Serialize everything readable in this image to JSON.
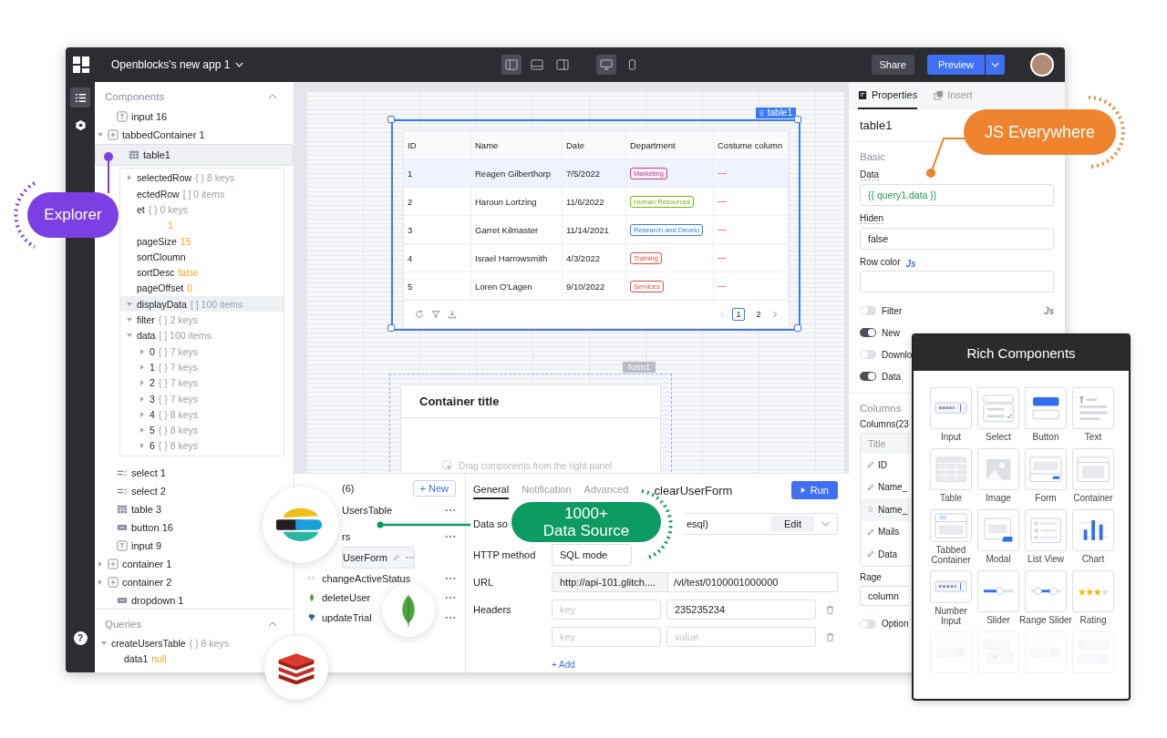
{
  "topbar": {
    "app_title": "Openblocks's new app 1",
    "layout_modes": [
      {
        "selected": true
      },
      {
        "selected": false
      },
      {
        "selected": false
      }
    ],
    "devices": [
      {
        "kind": "desktop",
        "selected": true
      },
      {
        "kind": "mobile",
        "selected": false
      }
    ],
    "share": "Share",
    "preview": "Preview"
  },
  "rail": {
    "items": [
      {
        "kind": "tree",
        "selected": true
      },
      {
        "kind": "hexagon",
        "selected": false
      }
    ],
    "help": "?"
  },
  "components": {
    "title": "Components",
    "items": [
      {
        "label": "input 16",
        "kind": "input"
      },
      {
        "label": "tabbedContainer 1",
        "kind": "container",
        "expanded": true
      },
      {
        "label": "table1",
        "kind": "table",
        "selected": true
      }
    ]
  },
  "explorer": {
    "rows": [
      {
        "name": "selectedRow",
        "meta": "{ } 8 keys",
        "expanded": false,
        "selected": false
      },
      {
        "name": "ectedRow",
        "meta": "[ ] 0 items",
        "selected": false
      },
      {
        "name": "et",
        "meta": "{ } 0 keys",
        "selected": false
      },
      {
        "value": "1",
        "selected": false
      },
      {
        "name": "pageSize",
        "value": "15",
        "selected": false
      },
      {
        "name": "sortCloumn",
        "selected": false
      },
      {
        "name": "sortDesc",
        "value": "false",
        "selected": false
      },
      {
        "name": "pageOffset",
        "value": "0",
        "selected": false
      },
      {
        "name": "displayData",
        "meta": "[ ] 100 items",
        "expanded": true,
        "selected": true
      },
      {
        "name": "filter",
        "meta": "{ } 2 keys",
        "expanded": true,
        "selected": false
      },
      {
        "name": "data",
        "meta": "[ ] 100 items",
        "expanded": true,
        "selected": false,
        "children": [
          {
            "name": "0",
            "meta": "{ } 7 keys",
            "expanded": false
          },
          {
            "name": "1",
            "meta": "{ } 7 keys",
            "expanded": false
          },
          {
            "name": "2",
            "meta": "{ } 7 keys",
            "expanded": false
          },
          {
            "name": "3",
            "meta": "{ } 7 keys",
            "expanded": false
          },
          {
            "name": "4",
            "meta": "{ } 8 keys",
            "expanded": false
          },
          {
            "name": "5",
            "meta": "{ } 8 keys",
            "expanded": false
          },
          {
            "name": "6",
            "meta": "{ } 8 keys",
            "expanded": false
          }
        ]
      }
    ]
  },
  "components_more": [
    {
      "label": "select 1",
      "kind": "select"
    },
    {
      "label": "select 2",
      "kind": "select"
    },
    {
      "label": "table 3",
      "kind": "table"
    },
    {
      "label": "button 16",
      "kind": "button"
    },
    {
      "label": "input 9",
      "kind": "input"
    },
    {
      "label": "container 1",
      "kind": "container",
      "expanded": false
    },
    {
      "label": "container 2",
      "kind": "container",
      "expanded": false
    },
    {
      "label": "dropdown 1",
      "kind": "button"
    }
  ],
  "queries": {
    "title": "Queries",
    "items": [
      {
        "name": "createUsersTable",
        "meta": "{ } 8 keys",
        "expanded": true,
        "children": [
          {
            "name": "data1",
            "value": "null"
          }
        ]
      }
    ]
  },
  "table1": {
    "badge": "table1",
    "columns": [
      "ID",
      "Name",
      "Date",
      "Department",
      "Costume column"
    ],
    "rows": [
      {
        "id": "1",
        "name": "Reagen Gilberthorp",
        "date": "7/5/2022",
        "department": "Marketing",
        "color": "#d63384",
        "selected": true
      },
      {
        "id": "2",
        "name": "Haroun Lortzing",
        "date": "11/6/2022",
        "department": "Human Resources",
        "color": "#7cb305",
        "selected": false
      },
      {
        "id": "3",
        "name": "Garret Kilmaster",
        "date": "11/14/2021",
        "department": "Research and Develo",
        "color": "#2f80ed",
        "selected": false
      },
      {
        "id": "4",
        "name": "Israel Harrowsmith",
        "date": "4/3/2022",
        "department": "Training",
        "color": "#e5484d",
        "selected": false
      },
      {
        "id": "5",
        "name": "Loren O'Lagen",
        "date": "9/10/2022",
        "department": "Services",
        "color": "#e5484d",
        "selected": false
      }
    ],
    "pages": [
      {
        "label": "1",
        "selected": true
      },
      {
        "label": "2",
        "selected": false
      }
    ]
  },
  "form1": {
    "badge": "form1",
    "title": "Container title",
    "hint": "Drag components from the right panel"
  },
  "query_panel": {
    "count": "(6)",
    "new_button": "+ New",
    "items": [
      {
        "label": "UsersTable",
        "kind": "sql",
        "selected": false
      },
      {
        "label": "rs",
        "kind": "sql",
        "selected": false
      },
      {
        "label": "UserForm",
        "kind": "sql",
        "selected": true
      },
      {
        "label": "changeActiveStatus",
        "kind": "js",
        "selected": false
      },
      {
        "label": "deleteUser",
        "kind": "mongo",
        "selected": false
      },
      {
        "label": "updateTrial",
        "kind": "pg",
        "selected": false
      }
    ],
    "tabs": [
      {
        "label": "General",
        "selected": true
      },
      {
        "label": "Notification",
        "selected": false
      },
      {
        "label": "Advanced",
        "selected": false
      }
    ],
    "title": "clearUserForm",
    "run": "Run",
    "data_source": {
      "label": "Data so",
      "value": "esql)",
      "edit": "Edit"
    },
    "http_method": {
      "label": "HTTP method",
      "value": "SQL mode"
    },
    "url": {
      "label": "URL",
      "prefix": "http://api-101.glitch....",
      "path": "/vl/test/0100001000000"
    },
    "headers": {
      "label": "Headers",
      "rows": [
        {
          "key_placeholder": "key",
          "value": "235235234"
        },
        {
          "key_placeholder": "key",
          "value_placeholder": "value"
        }
      ],
      "add": "+ Add"
    }
  },
  "properties": {
    "tabs": [
      {
        "label": "Properties",
        "selected": true
      },
      {
        "label": "Insert",
        "selected": false
      }
    ],
    "title": "table1",
    "section": "Basic",
    "data": {
      "label": "Data",
      "value": "{{ query1.data }}"
    },
    "hidden": {
      "label": "Hiden",
      "value": "false"
    },
    "row_color": {
      "label": "Row color",
      "js": "Js"
    },
    "toggles": [
      {
        "label": "Filter",
        "on": false,
        "js": "Js"
      },
      {
        "label": "New",
        "on": true
      },
      {
        "label": "Downlo",
        "on": false
      },
      {
        "label": "Data",
        "on": true
      }
    ],
    "columns_section": "Columns",
    "columns_label": "Columns(23",
    "columns_header": "Title",
    "columns": [
      {
        "label": "ID",
        "kind": "edit"
      },
      {
        "label": "Name_",
        "kind": "edit"
      },
      {
        "label": "Name_",
        "kind": "drag"
      },
      {
        "label": "Mails",
        "kind": "edit"
      },
      {
        "label": "Data",
        "kind": "edit"
      }
    ],
    "rage": {
      "label": "Rage",
      "value": "column"
    },
    "option": {
      "label": "Option",
      "on": false
    }
  },
  "rich_components": {
    "title": "Rich Components",
    "items": [
      {
        "label": "Input",
        "kind": "input"
      },
      {
        "label": "Select",
        "kind": "select"
      },
      {
        "label": "Button",
        "kind": "button"
      },
      {
        "label": "Text",
        "kind": "text"
      },
      {
        "label": "Table",
        "kind": "table"
      },
      {
        "label": "Image",
        "kind": "image"
      },
      {
        "label": "Form",
        "kind": "form"
      },
      {
        "label": "Container",
        "kind": "container"
      },
      {
        "label": "Tabbed Container",
        "kind": "tabbed"
      },
      {
        "label": "Modal",
        "kind": "modal"
      },
      {
        "label": "List View",
        "kind": "list"
      },
      {
        "label": "Chart",
        "kind": "chart"
      },
      {
        "label": "Number Input",
        "kind": "number"
      },
      {
        "label": "Slider",
        "kind": "slider"
      },
      {
        "label": "Range Slider",
        "kind": "range"
      },
      {
        "label": "Rating",
        "kind": "rating"
      },
      {
        "kind": "date"
      },
      {
        "kind": "daterange"
      },
      {
        "kind": "time"
      },
      {
        "kind": "timerange"
      }
    ]
  },
  "callouts": {
    "explorer": "Explorer",
    "js": "JS Everywhere",
    "data_source": [
      "1000+",
      "Data Source"
    ]
  }
}
